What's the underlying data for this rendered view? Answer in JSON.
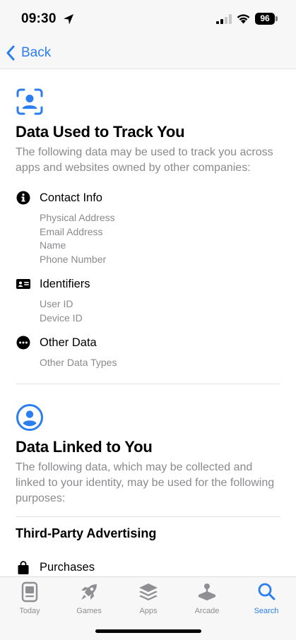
{
  "status_bar": {
    "time": "09:30",
    "battery": "96"
  },
  "nav": {
    "back_label": "Back"
  },
  "tracking_section": {
    "title": "Data Used to Track You",
    "description": "The following data may be used to track you across apps and websites owned by other companies:",
    "categories": [
      {
        "label": "Contact Info",
        "icon": "info-circle-icon",
        "items": [
          "Physical Address",
          "Email Address",
          "Name",
          "Phone Number"
        ]
      },
      {
        "label": "Identifiers",
        "icon": "id-card-icon",
        "items": [
          "User ID",
          "Device ID"
        ]
      },
      {
        "label": "Other Data",
        "icon": "ellipsis-circle-icon",
        "items": [
          "Other Data Types"
        ]
      }
    ]
  },
  "linked_section": {
    "title": "Data Linked to You",
    "description": "The following data, which may be collected and linked to your identity, may be used for the following purposes:",
    "purposes": [
      {
        "title": "Third-Party Advertising",
        "categories": [
          {
            "label": "Purchases",
            "icon": "shopping-bag-icon"
          }
        ]
      }
    ]
  },
  "tab_bar": {
    "accent_color": "#2a7ef0",
    "inactive_color": "#8e8e93",
    "tabs": [
      {
        "label": "Today",
        "icon": "today-icon",
        "active": false
      },
      {
        "label": "Games",
        "icon": "rocket-icon",
        "active": false
      },
      {
        "label": "Apps",
        "icon": "apps-stack-icon",
        "active": false
      },
      {
        "label": "Arcade",
        "icon": "arcade-joystick-icon",
        "active": false
      },
      {
        "label": "Search",
        "icon": "search-icon",
        "active": true
      }
    ]
  }
}
